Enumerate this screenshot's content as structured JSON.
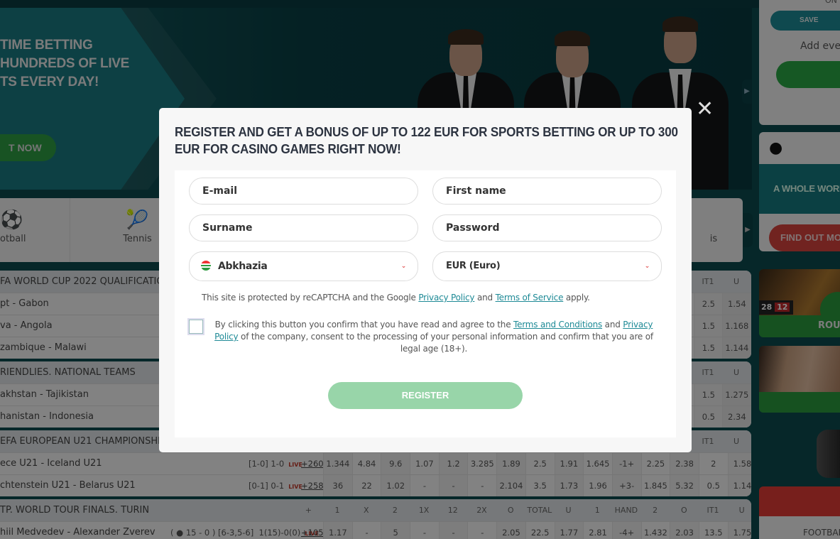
{
  "hero": {
    "headline_lines": [
      "TIME BETTING",
      "HUNDREDS OF LIVE",
      "TS EVERY DAY!"
    ],
    "cta_label": "T NOW"
  },
  "sports_tabs": [
    {
      "label": "otball",
      "icon": "football-icon"
    },
    {
      "label": "Tennis",
      "icon": "tennis-racket-icon"
    },
    {
      "label": "is",
      "icon": ""
    }
  ],
  "leagues": [
    {
      "name": "FA WORLD CUP 2022 QUALIFICATION",
      "right_headers": [
        "IT1",
        "U"
      ],
      "rows": [
        {
          "teams": "pt - Gabon",
          "right": [
            "2.5",
            "1.54"
          ]
        },
        {
          "teams": "va - Angola",
          "right": [
            "1.5",
            "1.168"
          ]
        },
        {
          "teams": "zambique - Malawi",
          "right": [
            "1.5",
            "1.144"
          ]
        }
      ]
    },
    {
      "name": "RIENDLIES. NATIONAL TEAMS",
      "right_headers": [
        "IT1",
        "U"
      ],
      "rows": [
        {
          "teams": "akhstan - Tajikistan",
          "right": [
            "1.5",
            "1.275"
          ]
        },
        {
          "teams": "hanistan - Indonesia",
          "right": [
            "0.5",
            "2.34"
          ]
        }
      ]
    },
    {
      "name": "EFA EUROPEAN U21 CHAMPIONSHIP",
      "right_headers": [
        "IT1",
        "U"
      ],
      "rows": [
        {
          "teams": "ece U21 - Iceland U21",
          "score": "[1-0] 1-0",
          "live": "LIVE",
          "more": "+260",
          "odds": [
            "1.344",
            "4.84",
            "9.6",
            "1.07",
            "1.2",
            "3.285",
            "1.89",
            "2.5",
            "1.91",
            "1.645",
            "-1+",
            "2.25",
            "2.38",
            "2",
            "1.58"
          ]
        },
        {
          "teams": "chtenstein U21 - Belarus U21",
          "score": "[0-1] 0-1",
          "live": "LIVE",
          "more": "+258",
          "odds": [
            "36",
            "22",
            "1.02",
            "-",
            "-",
            "-",
            "2.104",
            "3.5",
            "1.73",
            "1.96",
            "+3-",
            "1.845",
            "5.32",
            "0.5",
            "1.14"
          ]
        }
      ]
    },
    {
      "name": "TP. WORLD TOUR FINALS. TURIN",
      "headers": [
        "+",
        "1",
        "X",
        "2",
        "1X",
        "12",
        "2X",
        "O",
        "TOTAL",
        "U",
        "1",
        "HAND",
        "2",
        "O",
        "IT1",
        "U"
      ],
      "rows": [
        {
          "teams": "hiil Medvedev - Alexander Zverev",
          "score": "( ● 15 - 0 ) [6-3,5-6]  1(15)-0(0)",
          "live": "LIVE",
          "more": "+105",
          "odds": [
            "1.17",
            "-",
            "5",
            "-",
            "-",
            "-",
            "2.05",
            "22.5",
            "1.77",
            "2.81",
            "-4+",
            "1.432",
            "2.03",
            "13.5",
            "1.75"
          ]
        }
      ]
    }
  ],
  "sidebar": {
    "top_label": "ON",
    "save_label": "SAVE",
    "add_events_text": "Add ever",
    "apple_icon": "apple-icon",
    "promo_text": "A WHOLE WORL",
    "find_out_label": "FIND OUT MO",
    "roulette_label": "ROU",
    "roulette_numbers": [
      "28",
      "12"
    ],
    "football_label": "FOOTBAL"
  },
  "modal": {
    "title": "REGISTER AND GET A BONUS OF UP TO 122 EUR FOR SPORTS BETTING OR UP TO 300 EUR FOR CASINO GAMES RIGHT NOW!",
    "fields": {
      "email_placeholder": "E-mail",
      "first_name_placeholder": "First name",
      "surname_placeholder": "Surname",
      "password_placeholder": "Password",
      "country_value": "Abkhazia",
      "currency_value": "EUR (Euro)"
    },
    "recaptcha": {
      "prefix": "This site is protected by reCAPTCHA and the Google ",
      "privacy_link": "Privacy Policy",
      "middle": " and ",
      "terms_link": "Terms of Service",
      "suffix": " apply."
    },
    "consent": {
      "prefix": "By clicking this button you confirm that you have read and agree to the ",
      "terms_link": "Terms and Conditions",
      "middle": " and ",
      "privacy_link": "Privacy Policy",
      "suffix": " of the company, consent to the processing of your personal information and confirm that you are of legal age (18+).",
      "checked": false
    },
    "register_label": "REGISTER",
    "close_icon": "close-icon"
  },
  "colors": {
    "brand_teal": "#1e8a96",
    "register_button": "#98d5a9",
    "live_red": "#c0392b",
    "modal_title": "#2c3340"
  }
}
